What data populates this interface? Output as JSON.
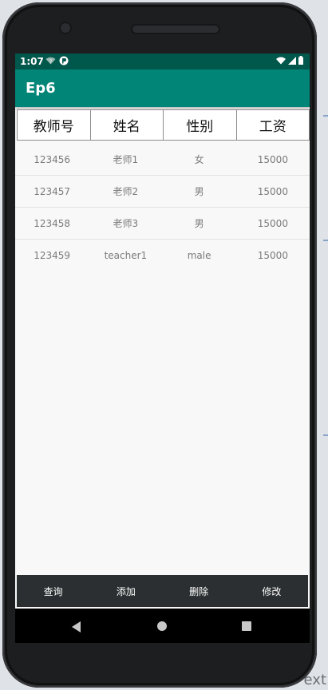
{
  "status_bar": {
    "time": "1:07"
  },
  "app_bar": {
    "title": "Ep6"
  },
  "table": {
    "headers": [
      "教师号",
      "姓名",
      "性别",
      "工资"
    ],
    "rows": [
      [
        "123456",
        "老师1",
        "女",
        "15000"
      ],
      [
        "123457",
        "老师2",
        "男",
        "15000"
      ],
      [
        "123458",
        "老师3",
        "男",
        "15000"
      ],
      [
        "123459",
        "teacher1",
        "male",
        "15000"
      ]
    ]
  },
  "bottom_bar": {
    "query_label": "查询",
    "add_label": "添加",
    "delete_label": "删除",
    "edit_label": "修改"
  },
  "background": {
    "ide_text": "ext"
  },
  "colors": {
    "status_bar": "#00574b",
    "app_bar": "#008577",
    "bottom_bar": "#2b2f31"
  }
}
